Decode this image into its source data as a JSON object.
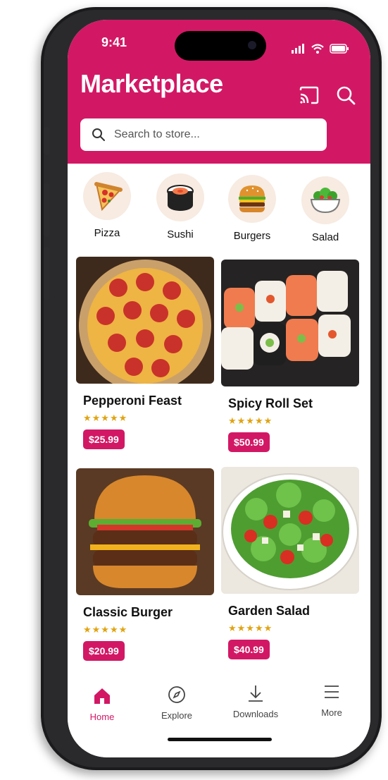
{
  "status": {
    "time": "9:41"
  },
  "header": {
    "title": "Marketplace"
  },
  "search": {
    "placeholder": "Search to store..."
  },
  "categories": [
    {
      "label": "Pizza",
      "icon": "pizza-icon"
    },
    {
      "label": "Sushi",
      "icon": "sushi-icon"
    },
    {
      "label": "Burgers",
      "icon": "burger-icon"
    },
    {
      "label": "Salad",
      "icon": "salad-icon"
    }
  ],
  "products": [
    {
      "name": "Pepperoni Feast",
      "stars": "★★★★★",
      "price": "$25.99"
    },
    {
      "name": "Spicy Roll Set",
      "stars": "★★★★★",
      "price": "$50.99"
    },
    {
      "name": "Classic Burger",
      "stars": "★★★★★",
      "price": "$20.99"
    },
    {
      "name": "Garden Salad",
      "stars": "★★★★★",
      "price": "$40.99"
    }
  ],
  "nav": [
    {
      "label": "Home",
      "icon": "home-icon",
      "active": true
    },
    {
      "label": "Explore",
      "icon": "compass-icon",
      "active": false
    },
    {
      "label": "Downloads",
      "icon": "download-icon",
      "active": false
    },
    {
      "label": "More",
      "icon": "menu-icon",
      "active": false
    }
  ],
  "colors": {
    "brand": "#d21864",
    "star": "#e0a412"
  }
}
